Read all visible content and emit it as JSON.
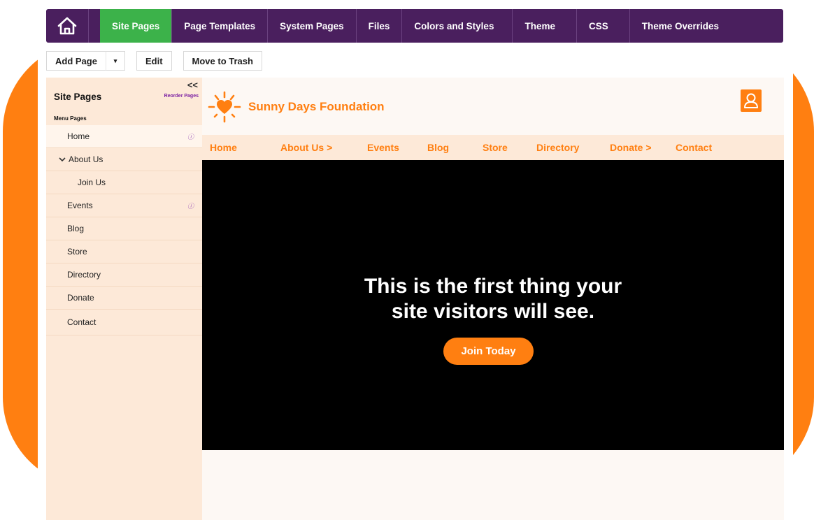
{
  "topnav": {
    "tabs": [
      {
        "label": "Site Pages"
      },
      {
        "label": "Page Templates"
      },
      {
        "label": "System Pages"
      },
      {
        "label": "Files"
      },
      {
        "label": "Colors and Styles"
      },
      {
        "label": "Theme"
      },
      {
        "label": "CSS"
      },
      {
        "label": "Theme Overrides"
      }
    ],
    "active_color": "#3cb24a",
    "bar_color": "#4a1f5e",
    "home_icon": "home-icon"
  },
  "toolbar": {
    "add_page_label": "Add Page",
    "caret_label": "▾",
    "edit_label": "Edit",
    "trash_label": "Move to Trash"
  },
  "sidebar": {
    "title": "Site Pages",
    "collapse_label": "<<",
    "reorder_label": "Reorder Pages",
    "section_label": "Menu Pages",
    "items": [
      {
        "label": "Home"
      },
      {
        "label": "About Us"
      },
      {
        "label": "Join Us"
      },
      {
        "label": "Events"
      },
      {
        "label": "Blog"
      },
      {
        "label": "Store"
      },
      {
        "label": "Directory"
      },
      {
        "label": "Donate"
      },
      {
        "label": "Contact"
      }
    ],
    "info_symbol": "ⓘ"
  },
  "preview": {
    "brand_name": "Sunny Days Foundation",
    "brand_color": "#ff7f11",
    "logo_icon": "sun-heart-icon",
    "account_icon": "user-icon",
    "nav": [
      {
        "label": "Home"
      },
      {
        "label": "About Us >"
      },
      {
        "label": "Events"
      },
      {
        "label": "Blog"
      },
      {
        "label": "Store"
      },
      {
        "label": "Directory"
      },
      {
        "label": "Donate >"
      },
      {
        "label": "Contact"
      }
    ],
    "hero_line1": "This is the first thing your",
    "hero_line2": "site visitors will see.",
    "hero_button": "Join Today"
  }
}
